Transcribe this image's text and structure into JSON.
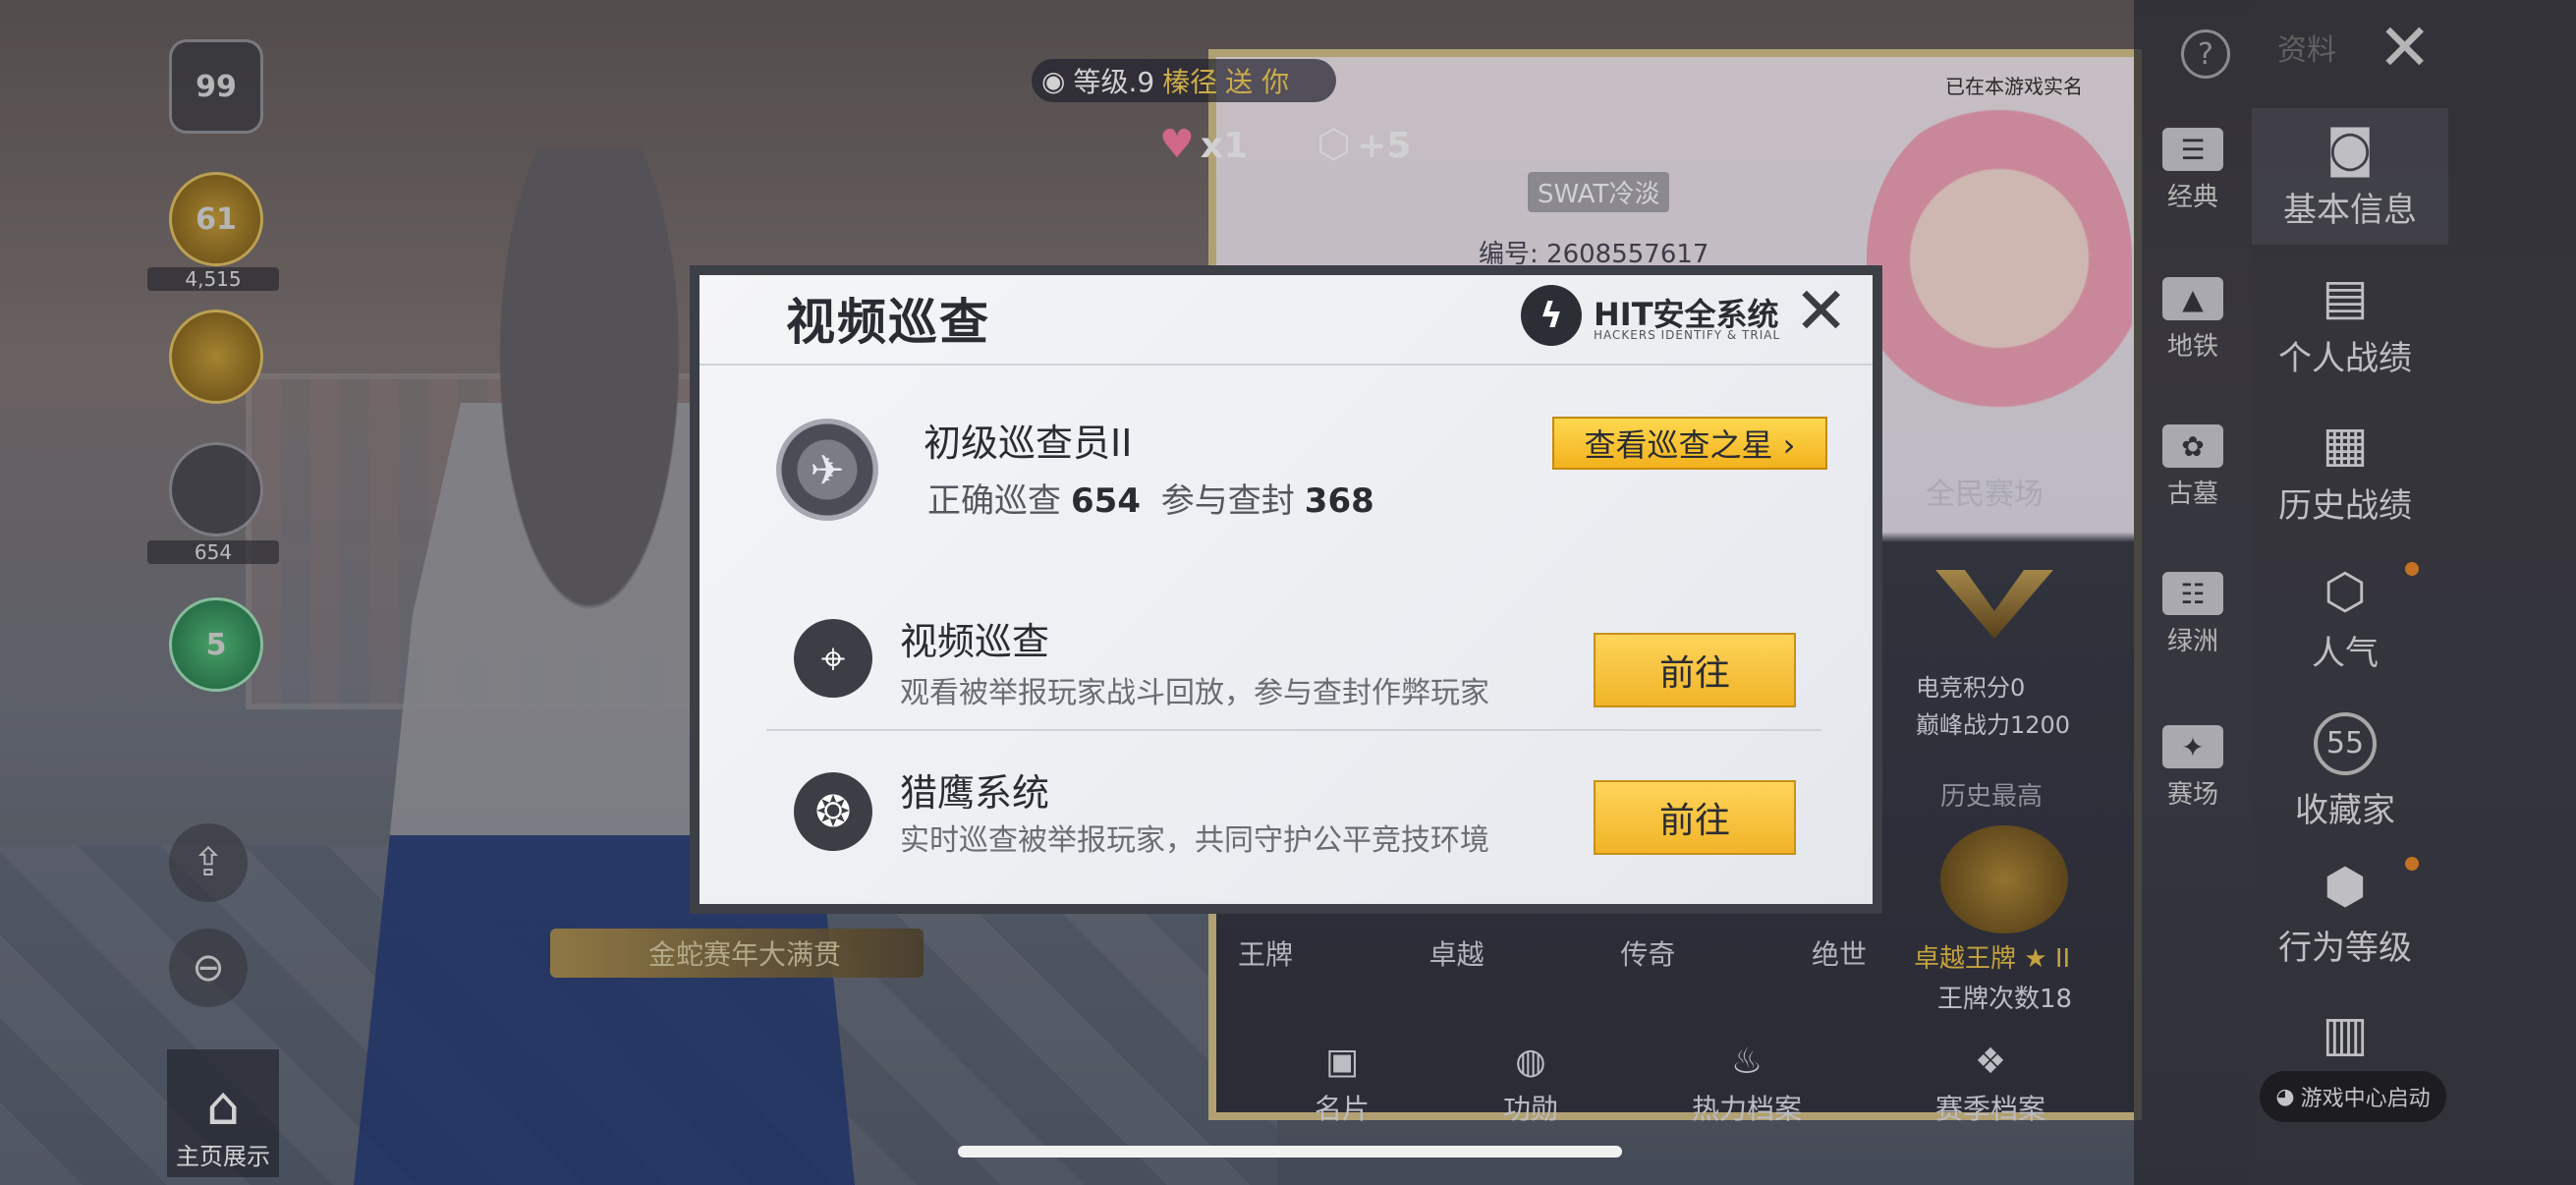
{
  "left_panel": {
    "badges": [
      "99",
      "61",
      "",
      "",
      "5"
    ],
    "badge_counts": [
      "4,515",
      "654"
    ],
    "home_show_label": "主页展示"
  },
  "gift_banner": {
    "level": "等级.9",
    "sender": "榛径",
    "verb": "送 你",
    "hearts_count": "x1",
    "popularity_count": "+5"
  },
  "profile_card": {
    "realname_note": "已在本游戏实名",
    "nickname": "SWAT冷淡",
    "uid": "编号: 2608557617",
    "stats_title": "全民赛场",
    "esports_score": "电竞积分0",
    "peak_power": "巅峰战力1200",
    "history_best": "历史最高",
    "rank": "卓越王牌 ★ II",
    "ace_count": "王牌次数18",
    "tiers": [
      "王牌",
      "卓越",
      "传奇",
      "绝世"
    ],
    "plaque": "金蛇赛年大满贯",
    "tabs": [
      "名片",
      "功勋",
      "热力档案",
      "赛季档案"
    ]
  },
  "nav_secondary": {
    "items": [
      "经典",
      "地铁",
      "古墓",
      "绿洲",
      "赛场"
    ]
  },
  "nav_primary": {
    "header": "资料",
    "items": [
      "基本信息",
      "个人战绩",
      "历史战绩",
      "人气",
      "收藏家",
      "行为等级"
    ],
    "collector_badge": "55",
    "game_center": "游戏中心启动"
  },
  "modal": {
    "title": "视频巡查",
    "brand": "HIT安全系统",
    "brand_sub": "HACKERS IDENTIFY & TRIAL",
    "rank_name": "初级巡查员II",
    "correct_label": "正确巡查",
    "correct_value": "654",
    "ban_label": "参与查封",
    "ban_value": "368",
    "star_button": "查看巡查之星 ›",
    "rows": [
      {
        "title": "视频巡查",
        "desc": "观看被举报玩家战斗回放，参与查封作弊玩家",
        "button": "前往"
      },
      {
        "title": "猎鹰系统",
        "desc": "实时巡查被举报玩家，共同守护公平竞技环境",
        "button": "前往"
      }
    ]
  },
  "colors": {
    "accent_yellow": "#f2b21e",
    "modal_bg": "#eceef2",
    "modal_border": "#3d3f47",
    "text_dark": "#2a2c33",
    "dot_orange": "#f08a2c"
  }
}
